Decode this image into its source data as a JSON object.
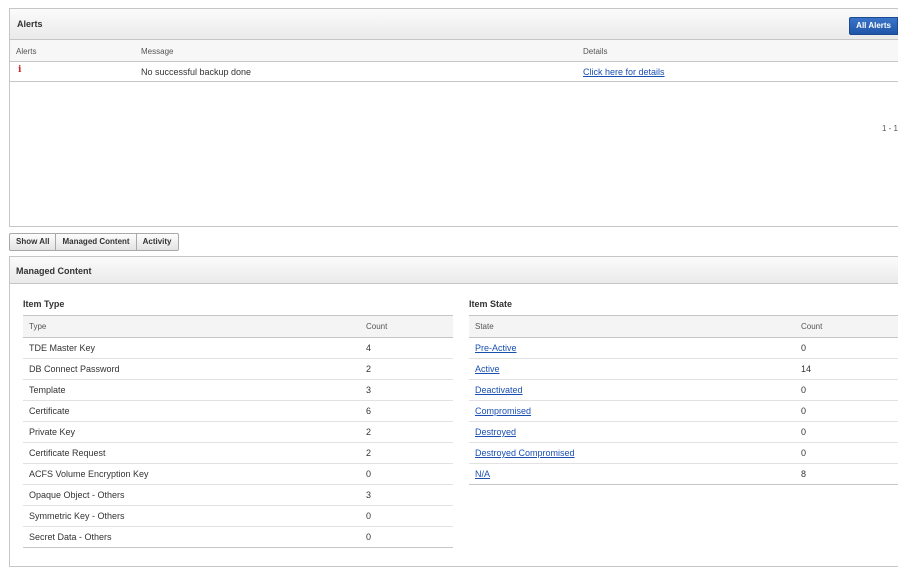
{
  "alerts": {
    "title": "Alerts",
    "all_alerts_label": "All Alerts",
    "columns": {
      "alerts": "Alerts",
      "message": "Message",
      "details": "Details"
    },
    "rows": [
      {
        "icon": "info-icon",
        "message": "No successful backup done",
        "details": "Click here for details"
      }
    ],
    "pager": "1 - 1"
  },
  "tabs": [
    "Show All",
    "Managed Content",
    "Activity"
  ],
  "managed_content": {
    "title": "Managed Content",
    "item_type": {
      "title": "Item Type",
      "columns": {
        "type": "Type",
        "count": "Count"
      },
      "rows": [
        {
          "type": "TDE Master Key",
          "count": "4"
        },
        {
          "type": "DB Connect Password",
          "count": "2"
        },
        {
          "type": "Template",
          "count": "3"
        },
        {
          "type": "Certificate",
          "count": "6"
        },
        {
          "type": "Private Key",
          "count": "2"
        },
        {
          "type": "Certificate Request",
          "count": "2"
        },
        {
          "type": "ACFS Volume Encryption Key",
          "count": "0"
        },
        {
          "type": "Opaque Object - Others",
          "count": "3"
        },
        {
          "type": "Symmetric Key - Others",
          "count": "0"
        },
        {
          "type": "Secret Data - Others",
          "count": "0"
        }
      ]
    },
    "item_state": {
      "title": "Item State",
      "columns": {
        "state": "State",
        "count": "Count"
      },
      "rows": [
        {
          "state": "Pre-Active",
          "count": "0"
        },
        {
          "state": "Active",
          "count": "14"
        },
        {
          "state": "Deactivated",
          "count": "0"
        },
        {
          "state": "Compromised",
          "count": "0"
        },
        {
          "state": "Destroyed",
          "count": "0"
        },
        {
          "state": "Destroyed Compromised",
          "count": "0"
        },
        {
          "state": "N/A",
          "count": "8"
        }
      ]
    }
  }
}
